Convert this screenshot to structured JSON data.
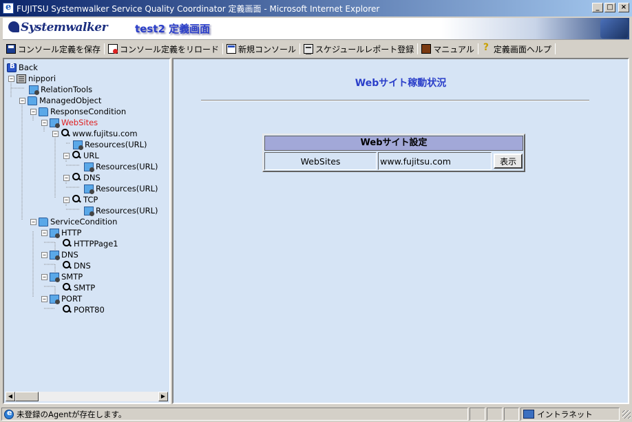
{
  "window": {
    "title": "FUJITSU Systemwalker Service Quality Coordinator 定義画面 - Microsoft Internet Explorer",
    "minimize_glyph": "_",
    "maximize_glyph": "□",
    "close_glyph": "×"
  },
  "banner": {
    "logo_text": "Systemwalker",
    "page_heading": "test2 定義画面"
  },
  "toolbar": {
    "save_console": "コンソール定義を保存",
    "reload_console": "コンソール定義をリロード",
    "new_console": "新規コンソール",
    "schedule_report": "スケジュールレポート登録",
    "manual": "マニュアル",
    "help": "定義画面ヘルプ"
  },
  "tree": {
    "back": "Back",
    "nippori": "nippori",
    "relation_tools": "RelationTools",
    "managed_object": "ManagedObject",
    "response_condition": "ResponseCondition",
    "websites": "WebSites",
    "www_fujitsu": "www.fujitsu.com",
    "resources_url_1": "Resources(URL)",
    "url": "URL",
    "resources_url_2": "Resources(URL)",
    "dns_resp": "DNS",
    "resources_url_3": "Resources(URL)",
    "tcp": "TCP",
    "resources_url_4": "Resources(URL)",
    "service_condition": "ServiceCondition",
    "http": "HTTP",
    "httppage1": "HTTPPage1",
    "dns_svc": "DNS",
    "dns_svc_child": "DNS",
    "smtp": "SMTP",
    "smtp_child": "SMTP",
    "port": "PORT",
    "port80": "PORT80",
    "expand_minus": "−",
    "scroll_left": "◀",
    "scroll_right": "▶"
  },
  "main": {
    "title": "Webサイト稼動状況",
    "table_header": "Webサイト設定",
    "row_name": "WebSites",
    "row_value": "www.fujitsu.com",
    "show_button": "表示"
  },
  "status": {
    "message": "未登録のAgentが存在します。",
    "zone": "イントラネット"
  }
}
